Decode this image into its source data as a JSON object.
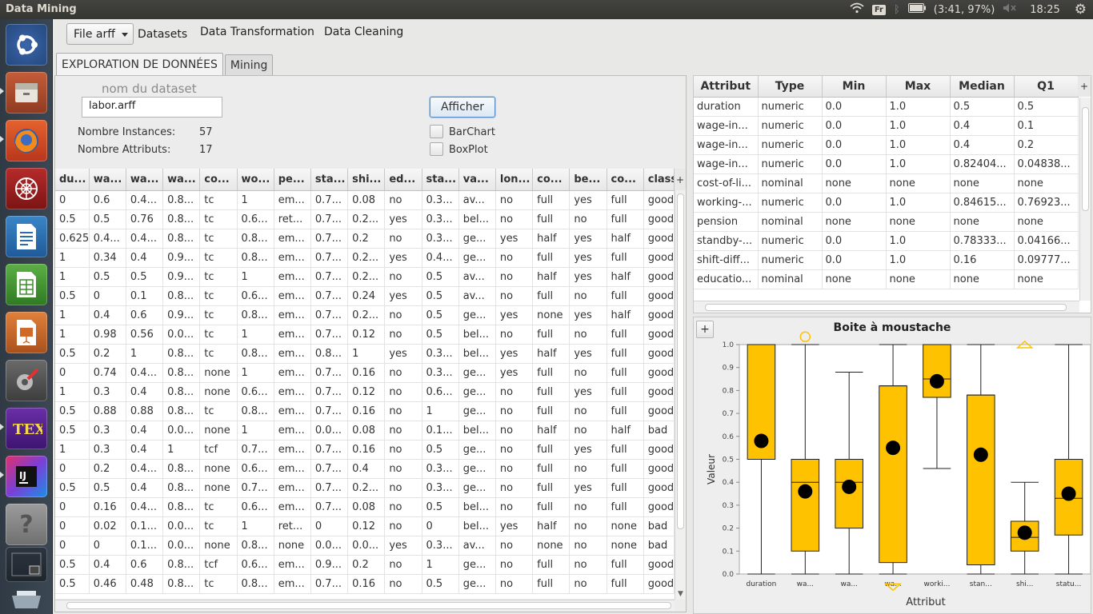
{
  "window": {
    "title": "Data Mining"
  },
  "tray": {
    "kbd": "Fr",
    "battery": "(3:41, 97%)",
    "clock": "18:25"
  },
  "launcher": [
    "ubuntu-dash",
    "files",
    "firefox",
    "network-tool",
    "writer",
    "calc",
    "impress",
    "system-settings",
    "texmaker",
    "intellij",
    "help",
    "workspaces",
    "trash"
  ],
  "menu": {
    "file_combo": "File arff",
    "items": [
      "Datasets",
      "Data Transformation",
      "Data Cleaning"
    ]
  },
  "tabs": [
    "EXPLORATION DE DONNÉES",
    "Mining"
  ],
  "dataset": {
    "name_label": "nom du dataset",
    "name_value": "labor.arff",
    "show_button": "Afficher",
    "instances_label": "Nombre Instances:",
    "instances_value": "57",
    "attributes_label": "Nombre Attributs:",
    "attributes_value": "17",
    "barchart_label": "BarChart",
    "boxplot_label": "BoxPlot"
  },
  "data_table": {
    "headers": [
      "du...",
      "wa...",
      "wa...",
      "wa...",
      "co...",
      "wo...",
      "pe...",
      "sta...",
      "shi...",
      "ed...",
      "sta...",
      "va...",
      "lon...",
      "co...",
      "be...",
      "co...",
      "class"
    ],
    "rows": [
      [
        "0",
        "0.6",
        "0.4...",
        "0.8...",
        "tc",
        "1",
        "em...",
        "0.7...",
        "0.08",
        "no",
        "0.3...",
        "av...",
        "no",
        "full",
        "yes",
        "full",
        "good"
      ],
      [
        "0.5",
        "0.5",
        "0.76",
        "0.8...",
        "tc",
        "0.6...",
        "ret...",
        "0.7...",
        "0.2...",
        "yes",
        "0.3...",
        "bel...",
        "no",
        "full",
        "no",
        "full",
        "good"
      ],
      [
        "0.625",
        "0.4...",
        "0.4...",
        "0.8...",
        "tc",
        "0.8...",
        "em...",
        "0.7...",
        "0.2",
        "no",
        "0.3...",
        "ge...",
        "yes",
        "half",
        "yes",
        "half",
        "good"
      ],
      [
        "1",
        "0.34",
        "0.4",
        "0.9...",
        "tc",
        "0.8...",
        "em...",
        "0.7...",
        "0.2...",
        "yes",
        "0.4...",
        "ge...",
        "no",
        "full",
        "yes",
        "full",
        "good"
      ],
      [
        "1",
        "0.5",
        "0.5",
        "0.9...",
        "tc",
        "1",
        "em...",
        "0.7...",
        "0.2...",
        "no",
        "0.5",
        "av...",
        "no",
        "half",
        "yes",
        "half",
        "good"
      ],
      [
        "0.5",
        "0",
        "0.1",
        "0.8...",
        "tc",
        "0.6...",
        "em...",
        "0.7...",
        "0.24",
        "yes",
        "0.5",
        "av...",
        "no",
        "full",
        "no",
        "full",
        "good"
      ],
      [
        "1",
        "0.4",
        "0.6",
        "0.9...",
        "tc",
        "0.8...",
        "em...",
        "0.7...",
        "0.2...",
        "no",
        "0.5",
        "ge...",
        "yes",
        "none",
        "yes",
        "half",
        "good"
      ],
      [
        "1",
        "0.98",
        "0.56",
        "0.0...",
        "tc",
        "1",
        "em...",
        "0.7...",
        "0.12",
        "no",
        "0.5",
        "bel...",
        "no",
        "full",
        "no",
        "full",
        "good"
      ],
      [
        "0.5",
        "0.2",
        "1",
        "0.8...",
        "tc",
        "0.8...",
        "em...",
        "0.8...",
        "1",
        "yes",
        "0.3...",
        "bel...",
        "yes",
        "half",
        "yes",
        "full",
        "good"
      ],
      [
        "0",
        "0.74",
        "0.4...",
        "0.8...",
        "none",
        "1",
        "em...",
        "0.7...",
        "0.16",
        "no",
        "0.3...",
        "ge...",
        "yes",
        "full",
        "no",
        "full",
        "good"
      ],
      [
        "1",
        "0.3",
        "0.4",
        "0.8...",
        "none",
        "0.6...",
        "em...",
        "0.7...",
        "0.12",
        "no",
        "0.6...",
        "ge...",
        "no",
        "full",
        "yes",
        "full",
        "good"
      ],
      [
        "0.5",
        "0.88",
        "0.88",
        "0.8...",
        "tc",
        "0.8...",
        "em...",
        "0.7...",
        "0.16",
        "no",
        "1",
        "ge...",
        "no",
        "full",
        "no",
        "full",
        "good"
      ],
      [
        "0.5",
        "0.3",
        "0.4",
        "0.0...",
        "none",
        "1",
        "em...",
        "0.0...",
        "0.08",
        "no",
        "0.1...",
        "bel...",
        "no",
        "half",
        "no",
        "half",
        "bad"
      ],
      [
        "1",
        "0.3",
        "0.4",
        "1",
        "tcf",
        "0.7...",
        "em...",
        "0.7...",
        "0.16",
        "no",
        "0.5",
        "ge...",
        "no",
        "full",
        "yes",
        "full",
        "good"
      ],
      [
        "0",
        "0.2",
        "0.4...",
        "0.8...",
        "none",
        "0.6...",
        "em...",
        "0.7...",
        "0.4",
        "no",
        "0.3...",
        "ge...",
        "no",
        "full",
        "no",
        "full",
        "good"
      ],
      [
        "0.5",
        "0.5",
        "0.4",
        "0.8...",
        "none",
        "0.7...",
        "em...",
        "0.7...",
        "0.2...",
        "no",
        "0.3...",
        "ge...",
        "no",
        "full",
        "yes",
        "full",
        "good"
      ],
      [
        "0",
        "0.16",
        "0.4...",
        "0.8...",
        "tc",
        "0.6...",
        "em...",
        "0.7...",
        "0.08",
        "no",
        "0.5",
        "bel...",
        "no",
        "full",
        "no",
        "full",
        "good"
      ],
      [
        "0",
        "0.02",
        "0.1...",
        "0.0...",
        "tc",
        "1",
        "ret...",
        "0",
        "0.12",
        "no",
        "0",
        "bel...",
        "yes",
        "half",
        "no",
        "none",
        "bad"
      ],
      [
        "0",
        "0",
        "0.1...",
        "0.0...",
        "none",
        "0.8...",
        "none",
        "0.0...",
        "0.0...",
        "yes",
        "0.3...",
        "av...",
        "no",
        "none",
        "no",
        "none",
        "bad"
      ],
      [
        "0.5",
        "0.4",
        "0.6",
        "0.8...",
        "tcf",
        "0.6...",
        "em...",
        "0.9...",
        "0.2",
        "no",
        "1",
        "ge...",
        "no",
        "full",
        "no",
        "full",
        "good"
      ],
      [
        "0.5",
        "0.46",
        "0.48",
        "0.8...",
        "tc",
        "0.8...",
        "em...",
        "0.7...",
        "0.16",
        "no",
        "0.5",
        "ge...",
        "no",
        "full",
        "no",
        "full",
        "good"
      ]
    ]
  },
  "attr_table": {
    "headers": [
      "Attribut",
      "Type",
      "Min",
      "Max",
      "Median",
      "Q1"
    ],
    "rows": [
      [
        "duration",
        "numeric",
        "0.0",
        "1.0",
        "0.5",
        "0.5"
      ],
      [
        "wage-in...",
        "numeric",
        "0.0",
        "1.0",
        "0.4",
        "0.1"
      ],
      [
        "wage-in...",
        "numeric",
        "0.0",
        "1.0",
        "0.4",
        "0.2"
      ],
      [
        "wage-in...",
        "numeric",
        "0.0",
        "1.0",
        "0.82404...",
        "0.04838..."
      ],
      [
        "cost-of-li...",
        "nominal",
        "none",
        "none",
        "none",
        "none"
      ],
      [
        "working-...",
        "numeric",
        "0.0",
        "1.0",
        "0.84615...",
        "0.76923..."
      ],
      [
        "pension",
        "nominal",
        "none",
        "none",
        "none",
        "none"
      ],
      [
        "standby-...",
        "numeric",
        "0.0",
        "1.0",
        "0.78333...",
        "0.04166..."
      ],
      [
        "shift-diff...",
        "numeric",
        "0.0",
        "1.0",
        "0.16",
        "0.09777..."
      ],
      [
        "educatio...",
        "nominal",
        "none",
        "none",
        "none",
        "none"
      ]
    ]
  },
  "chart_data": {
    "type": "boxplot",
    "title": "Boite à moustache",
    "xlabel": "Attribut",
    "ylabel": "Valeur",
    "ylim": [
      0,
      1.0
    ],
    "yticks": [
      "0.0",
      "0.1",
      "0.2",
      "0.3",
      "0.4",
      "0.5",
      "0.6",
      "0.7",
      "0.8",
      "0.9",
      "1.0"
    ],
    "fill": "#ffc200",
    "categories": [
      "duration",
      "wa...",
      "wa...",
      "wa...",
      "worki...",
      "stan...",
      "shi...",
      "statu..."
    ],
    "boxes": [
      {
        "min": 0.0,
        "q1": 0.5,
        "median": 0.5,
        "q3": 1.0,
        "max": 1.0,
        "mean": 0.58
      },
      {
        "min": 0.0,
        "q1": 0.1,
        "median": 0.4,
        "q3": 0.5,
        "max": 1.0,
        "mean": 0.36
      },
      {
        "min": 0.0,
        "q1": 0.2,
        "median": 0.4,
        "q3": 0.5,
        "max": 0.88,
        "mean": 0.38
      },
      {
        "min": 0.0,
        "q1": 0.05,
        "median": 0.82,
        "q3": 0.82,
        "max": 1.0,
        "mean": 0.55
      },
      {
        "min": 0.46,
        "q1": 0.77,
        "median": 0.85,
        "q3": 1.0,
        "max": 1.0,
        "mean": 0.84
      },
      {
        "min": 0.0,
        "q1": 0.04,
        "median": 0.78,
        "q3": 0.78,
        "max": 1.0,
        "mean": 0.52
      },
      {
        "min": 0.0,
        "q1": 0.1,
        "median": 0.16,
        "q3": 0.23,
        "max": 0.4,
        "mean": 0.18
      },
      {
        "min": 0.0,
        "q1": 0.17,
        "median": 0.33,
        "q3": 0.5,
        "max": 1.0,
        "mean": 0.35
      }
    ],
    "outliers": [
      {
        "series": 1,
        "value": 1.02,
        "shape": "circle"
      },
      {
        "series": 3,
        "value": -0.05,
        "shape": "triangle-down"
      },
      {
        "series": 6,
        "value": 1.0,
        "shape": "triangle-up"
      }
    ]
  }
}
